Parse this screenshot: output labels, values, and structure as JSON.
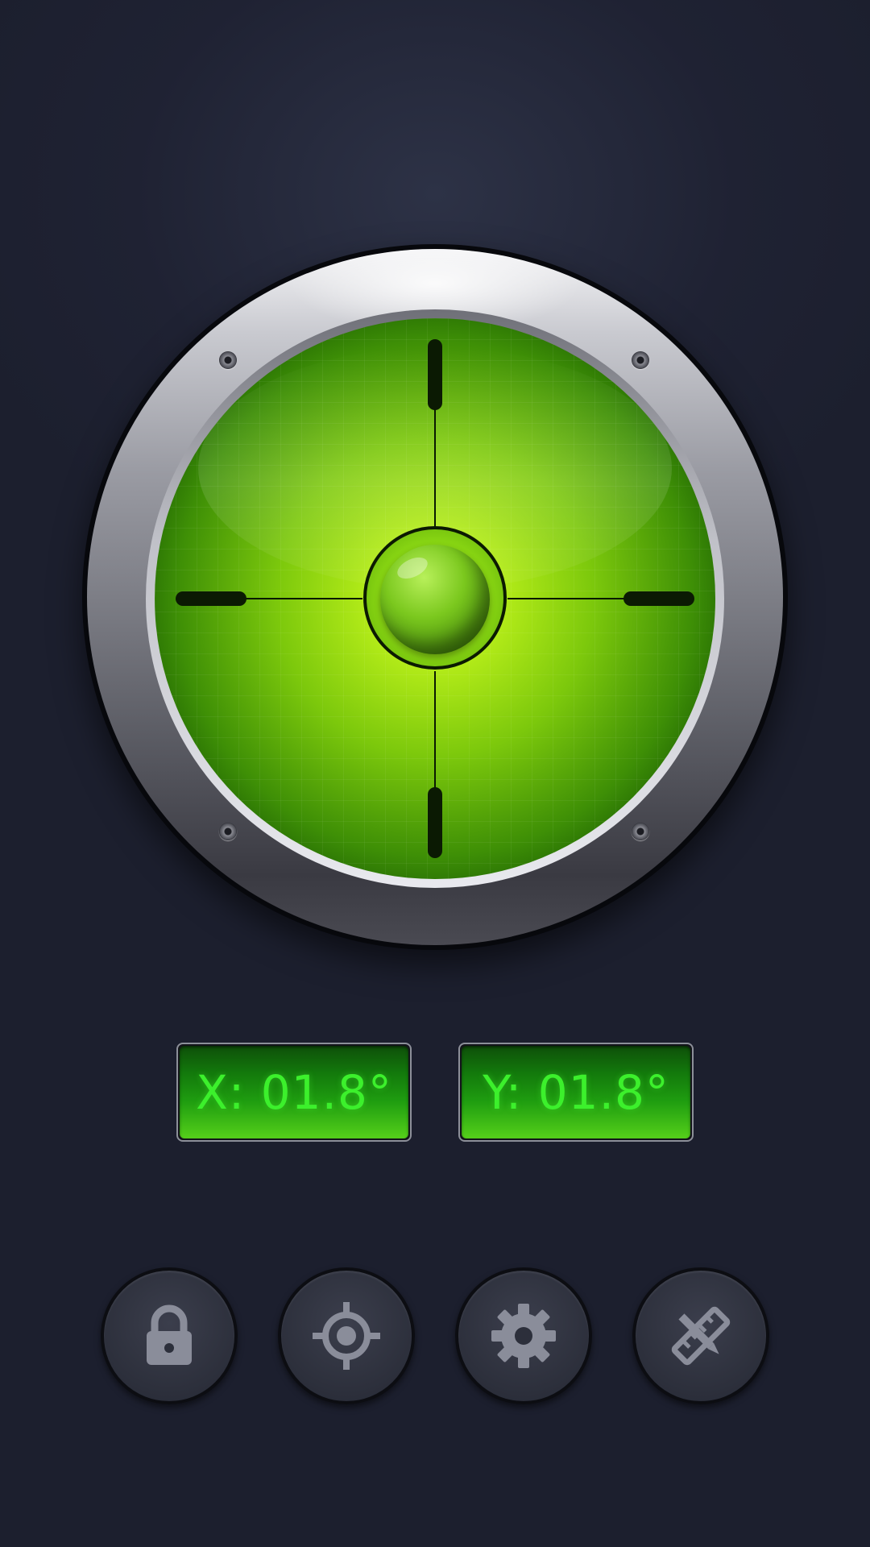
{
  "level": {
    "x_readout": "X: 01.8°",
    "y_readout": "Y: 01.8°",
    "bubble_offset": {
      "x_deg": 1.8,
      "y_deg": 1.8
    }
  },
  "colors": {
    "accent_green": "#3cf02c",
    "dial_green": "#b1ea18",
    "background": "#1f2233"
  },
  "controls": [
    {
      "icon": "lock-icon"
    },
    {
      "icon": "crosshair-icon"
    },
    {
      "icon": "gear-icon"
    },
    {
      "icon": "ruler-pencil-icon"
    }
  ]
}
